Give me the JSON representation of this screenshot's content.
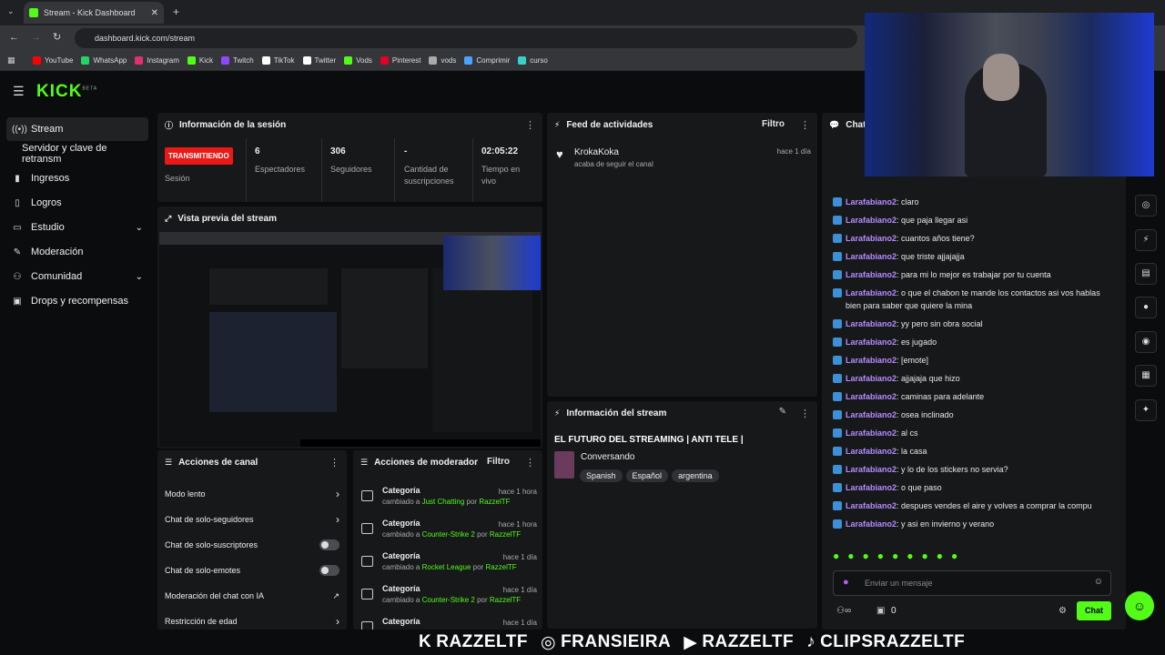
{
  "browser": {
    "tab_title": "Stream - Kick Dashboard",
    "url": "dashboard.kick.com/stream",
    "bookmarks": [
      {
        "label": "YouTube",
        "color": "#ff0000"
      },
      {
        "label": "WhatsApp",
        "color": "#25d366"
      },
      {
        "label": "Instagram",
        "color": "#e1306c"
      },
      {
        "label": "Kick",
        "color": "#53fc18"
      },
      {
        "label": "Twitch",
        "color": "#9146ff"
      },
      {
        "label": "TikTok",
        "color": "#ffffff"
      },
      {
        "label": "Twitter",
        "color": "#ffffff"
      },
      {
        "label": "Vods",
        "color": "#53fc18"
      },
      {
        "label": "Pinterest",
        "color": "#e60023"
      },
      {
        "label": "vods",
        "color": "#aaaaaa"
      },
      {
        "label": "Comprimir",
        "color": "#4aa3ff"
      },
      {
        "label": "curso",
        "color": "#3ad0c8"
      }
    ]
  },
  "brand": {
    "logo": "KICK",
    "beta": "BETA",
    "accent": "#53fc18"
  },
  "sidebar": {
    "items": [
      {
        "label": "Stream",
        "icon": "broadcast-icon",
        "active": true
      },
      {
        "label": "Servidor y clave de retransm",
        "icon": ""
      },
      {
        "label": "Ingresos",
        "icon": "bar-chart-icon"
      },
      {
        "label": "Logros",
        "icon": "book-icon"
      },
      {
        "label": "Estudio",
        "icon": "monitor-icon"
      },
      {
        "label": "Moderación",
        "icon": "wrench-icon"
      },
      {
        "label": "Comunidad",
        "icon": "people-icon"
      },
      {
        "label": "Drops y recompensas",
        "icon": "gift-icon"
      }
    ]
  },
  "session": {
    "title": "Información de la sesión",
    "live_badge": "TRANSMITIENDO",
    "session_label": "Sesión",
    "stats": [
      {
        "value": "6",
        "label": "Espectadores"
      },
      {
        "value": "306",
        "label": "Seguidores"
      },
      {
        "value": "-",
        "label": "Cantidad de suscripciones"
      },
      {
        "value": "02:05:22",
        "label": "Tiempo en vivo"
      }
    ]
  },
  "activity": {
    "title": "Feed de actividades",
    "filter": "Filtro",
    "items": [
      {
        "user": "KrokaKoka",
        "action": "acaba de seguir el canal",
        "time": "hace 1 día"
      }
    ]
  },
  "preview": {
    "title": "Vista previa del stream"
  },
  "stream_info": {
    "title": "Información del stream",
    "stream_title": "EL FUTURO DEL STREAMING | ANTI TELE |",
    "category": "Conversando",
    "tags": [
      "Spanish",
      "Español",
      "argentina"
    ]
  },
  "channel_actions": {
    "title": "Acciones de canal",
    "items": [
      {
        "label": "Modo lento",
        "control": "chevron"
      },
      {
        "label": "Chat de solo-seguidores",
        "control": "chevron"
      },
      {
        "label": "Chat de solo-suscriptores",
        "control": "toggle"
      },
      {
        "label": "Chat de solo-emotes",
        "control": "toggle"
      },
      {
        "label": "Moderación del chat con IA",
        "control": "external"
      },
      {
        "label": "Restricción de edad",
        "control": "chevron"
      }
    ]
  },
  "mod_actions": {
    "title": "Acciones de moderador",
    "filter": "Filtro",
    "items": [
      {
        "title": "Categoría",
        "prefix": "cambiado a",
        "category": "Just Chatting",
        "by": "por",
        "user": "RazzelTF",
        "time": "hace 1 hora"
      },
      {
        "title": "Categoría",
        "prefix": "cambiado a",
        "category": "Counter-Strike 2",
        "by": "por",
        "user": "RazzelTF",
        "time": "hace 1 hora"
      },
      {
        "title": "Categoría",
        "prefix": "cambiado a",
        "category": "Rocket League",
        "by": "por",
        "user": "RazzelTF",
        "time": "hace 1 día"
      },
      {
        "title": "Categoría",
        "prefix": "cambiado a",
        "category": "Counter-Strike 2",
        "by": "por",
        "user": "RazzelTF",
        "time": "hace 1 día"
      },
      {
        "title": "Categoría",
        "prefix": "",
        "category": "",
        "by": "",
        "user": "",
        "time": "hace 1 día"
      }
    ]
  },
  "chat": {
    "title": "Chat",
    "input_placeholder": "Enviar un mensaje",
    "send_label": "Chat",
    "points": "0",
    "messages": [
      {
        "user": "Larafabiano2",
        "text": "claro"
      },
      {
        "user": "Larafabiano2",
        "text": "que paja llegar asi"
      },
      {
        "user": "Larafabiano2",
        "text": "cuantos años tiene?"
      },
      {
        "user": "Larafabiano2",
        "text": "que triste ajjajajja"
      },
      {
        "user": "Larafabiano2",
        "text": "para mi lo mejor es trabajar por tu cuenta"
      },
      {
        "user": "Larafabiano2",
        "text": "o que el chabon te mande los contactos asi vos hablas bien para saber que quiere la mina"
      },
      {
        "user": "Larafabiano2",
        "text": "yy pero sin obra social"
      },
      {
        "user": "Larafabiano2",
        "text": "es jugado"
      },
      {
        "user": "Larafabiano2",
        "text": "[emote]"
      },
      {
        "user": "Larafabiano2",
        "text": "ajjajaja que hizo"
      },
      {
        "user": "Larafabiano2",
        "text": "caminas para adelante"
      },
      {
        "user": "Larafabiano2",
        "text": "osea inclinado"
      },
      {
        "user": "Larafabiano2",
        "text": "al cs"
      },
      {
        "user": "Larafabiano2",
        "text": "la casa"
      },
      {
        "user": "Larafabiano2",
        "text": "y lo de los stickers no servia?"
      },
      {
        "user": "Larafabiano2",
        "text": "o que paso"
      },
      {
        "user": "Larafabiano2",
        "text": "despues vendes el aire y volves a comprar la compu"
      },
      {
        "user": "Larafabiano2",
        "text": "y asi en invierno y verano"
      }
    ]
  },
  "overlay": {
    "items": [
      {
        "icon": "K",
        "label": "RAZZELTF"
      },
      {
        "icon": "◎",
        "label": "FRANSIEIRA"
      },
      {
        "icon": "▶",
        "label": "RAZZELTF"
      },
      {
        "icon": "♪",
        "label": "CLIPSRAZZELTF"
      }
    ]
  }
}
